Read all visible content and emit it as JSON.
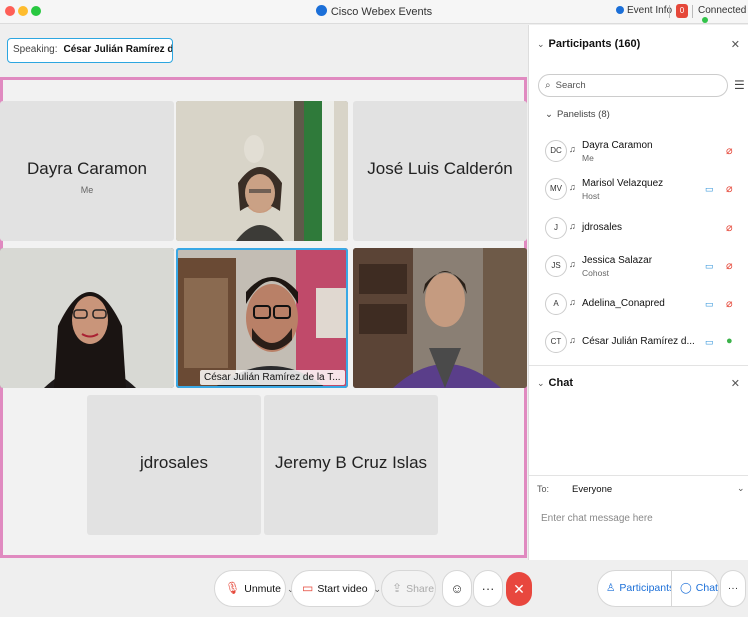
{
  "window": {
    "title": "Cisco Webex Events",
    "event_info": "Event Info",
    "connection_status": "Connected"
  },
  "speaking": {
    "label": "Speaking:",
    "name": "César Julián Ramírez de la..."
  },
  "stage": {
    "tiles": [
      {
        "name": "Dayra Caramon",
        "sub": "Me",
        "video": false
      },
      {
        "name": "",
        "sub": "",
        "video": true
      },
      {
        "name": "José Luis Calderón",
        "sub": "",
        "video": false
      },
      {
        "name": "",
        "sub": "",
        "video": true
      },
      {
        "name": "César Julián Ramírez de la T...",
        "sub": "",
        "video": true,
        "active": true
      },
      {
        "name": "",
        "sub": "",
        "video": true
      },
      {
        "name": "jdrosales",
        "sub": "",
        "video": false
      },
      {
        "name": "Jeremy B Cruz Islas",
        "sub": "",
        "video": false
      }
    ]
  },
  "toolbar": {
    "unmute": "Unmute",
    "start_video": "Start video",
    "share": "Share",
    "more": "···",
    "end": "✕",
    "participants": "Participants",
    "chat": "Chat"
  },
  "participants_panel": {
    "title": "Participants (160)",
    "search_placeholder": "Search",
    "panelists_label": "Panelists (8)",
    "rows": [
      {
        "initials": "DC",
        "name": "Dayra Caramon",
        "role": "Me",
        "video": false,
        "mic": "muted"
      },
      {
        "initials": "MV",
        "name": "Marisol Velazquez",
        "role": "Host",
        "video": true,
        "mic": "muted"
      },
      {
        "initials": "J",
        "name": "jdrosales",
        "role": "",
        "video": false,
        "mic": "muted"
      },
      {
        "initials": "JS",
        "name": "Jessica Salazar",
        "role": "Cohost",
        "video": true,
        "mic": "muted"
      },
      {
        "initials": "A",
        "name": "Adelina_Conapred",
        "role": "",
        "video": true,
        "mic": "muted"
      },
      {
        "initials": "CT",
        "name": "César Julián Ramírez d...",
        "role": "",
        "video": true,
        "mic": "on"
      }
    ]
  },
  "chat_panel": {
    "title": "Chat",
    "to_label": "To:",
    "to_value": "Everyone",
    "input_placeholder": "Enter chat message here"
  }
}
